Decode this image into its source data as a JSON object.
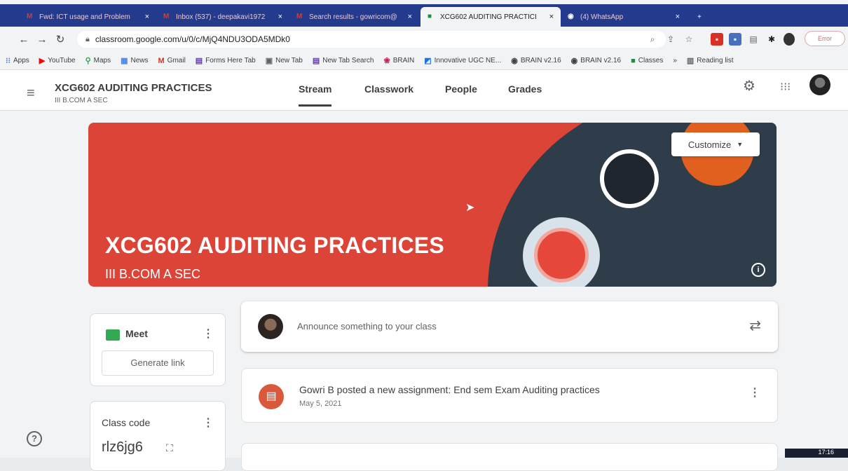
{
  "browser": {
    "tabs": [
      {
        "label": "Fwd: ICT usage and Problem",
        "icon": "gmail-icon",
        "active": false
      },
      {
        "label": "Inbox (537) - deepakavi1972",
        "icon": "gmail-icon",
        "active": false
      },
      {
        "label": "Search results - gowricom@",
        "icon": "gmail-icon",
        "active": false
      },
      {
        "label": "XCG602 AUDITING PRACTICI",
        "icon": "classroom-icon",
        "active": true
      },
      {
        "label": "(4) WhatsApp",
        "icon": "whatsapp-icon",
        "active": false
      }
    ],
    "url": "classroom.google.com/u/0/c/MjQ4NDU3ODA5MDk0",
    "profile_label": "Error",
    "bookmarks": [
      {
        "label": "Apps",
        "icon": "apps-grid-icon"
      },
      {
        "label": "YouTube",
        "icon": "youtube-icon"
      },
      {
        "label": "Maps",
        "icon": "maps-pin-icon"
      },
      {
        "label": "News",
        "icon": "news-icon"
      },
      {
        "label": "Gmail",
        "icon": "gmail-icon"
      },
      {
        "label": "Forms Here Tab",
        "icon": "forms-icon"
      },
      {
        "label": "New Tab",
        "icon": "newtab-icon"
      },
      {
        "label": "New Tab Search",
        "icon": "forms-icon"
      },
      {
        "label": "BRAIN",
        "icon": "brain-icon"
      },
      {
        "label": "Innovative UGC NE...",
        "icon": "ugc-icon"
      },
      {
        "label": "BRAIN v2.16",
        "icon": "globe-icon"
      },
      {
        "label": "BRAIN v2.16",
        "icon": "globe-icon"
      },
      {
        "label": "Classes",
        "icon": "classroom-icon"
      },
      {
        "label": "»",
        "icon": "more-icon"
      },
      {
        "label": "Reading list",
        "icon": "reading-list-icon"
      }
    ]
  },
  "header": {
    "course_title": "XCG602 AUDITING PRACTICES",
    "course_section": "III B.COM A SEC",
    "tabs": [
      {
        "label": "Stream",
        "active": true
      },
      {
        "label": "Classwork",
        "active": false
      },
      {
        "label": "People",
        "active": false
      },
      {
        "label": "Grades",
        "active": false
      }
    ]
  },
  "banner": {
    "title": "XCG602 AUDITING PRACTICES",
    "subtitle": "III B.COM A SEC",
    "customize_label": "Customize",
    "color": "#db4437"
  },
  "sidebar": {
    "meet_label": "Meet",
    "generate_link_label": "Generate link",
    "class_code_label": "Class code",
    "class_code": "rlz6jg6"
  },
  "stream": {
    "announce_placeholder": "Announce something to your class",
    "posts": [
      {
        "title": "Gowri B posted a new assignment: End sem Exam Auditing practices",
        "date": "May 5, 2021"
      }
    ]
  },
  "system": {
    "clock": "17:16"
  }
}
